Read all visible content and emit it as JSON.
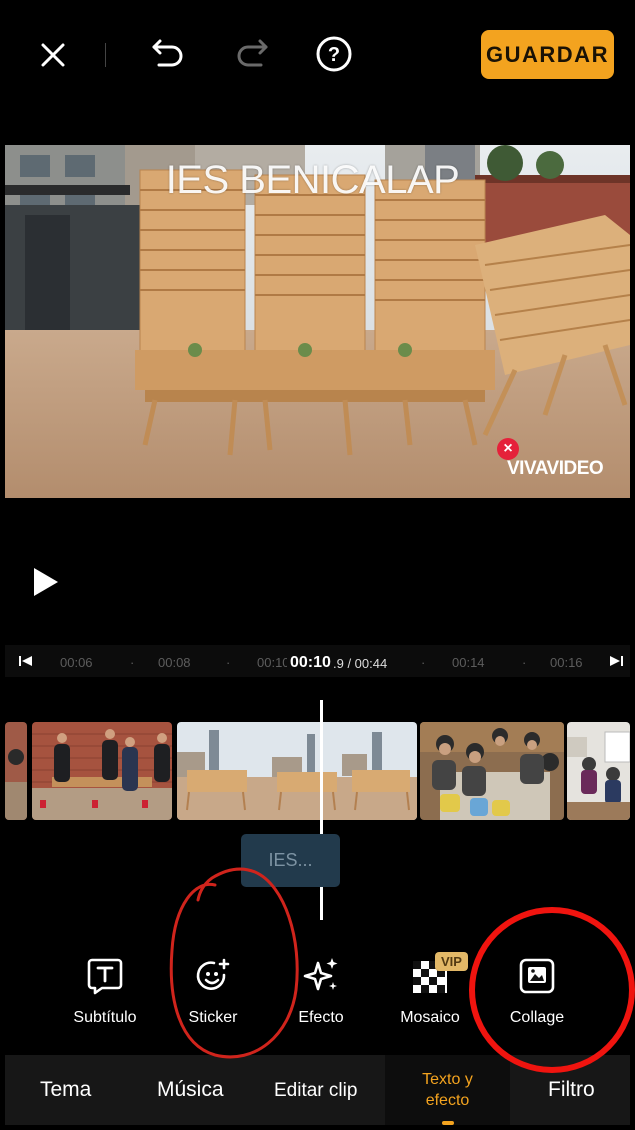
{
  "topbar": {
    "close_icon": "close-icon",
    "undo_icon": "undo-icon",
    "redo_icon": "redo-icon",
    "help_icon": "help-icon",
    "save_label": "GUARDAR",
    "accent": "#f3a31f"
  },
  "preview": {
    "overlay_text": "IES BENICALAP",
    "watermark": "VIVAVIDEO",
    "watermark_close": "×"
  },
  "timeline": {
    "ticks": [
      "00:06",
      "00:08",
      "00:10",
      "00:14",
      "00:16"
    ],
    "current_time": "00:10",
    "total_time": ".9 / 00:44",
    "text_clip_label": "IES..."
  },
  "tools": [
    {
      "label": "Subtítulo",
      "icon": "subtitle-icon"
    },
    {
      "label": "Sticker",
      "icon": "sticker-icon"
    },
    {
      "label": "Efecto",
      "icon": "effect-icon"
    },
    {
      "label": "Mosaico",
      "icon": "mosaic-icon",
      "badge": "VIP"
    },
    {
      "label": "Collage",
      "icon": "collage-icon"
    }
  ],
  "tabs": {
    "theme": "Tema",
    "music": "Música",
    "edit_clip": "Editar clip",
    "text_effect": "Texto y efecto",
    "filter": "Filtro"
  }
}
